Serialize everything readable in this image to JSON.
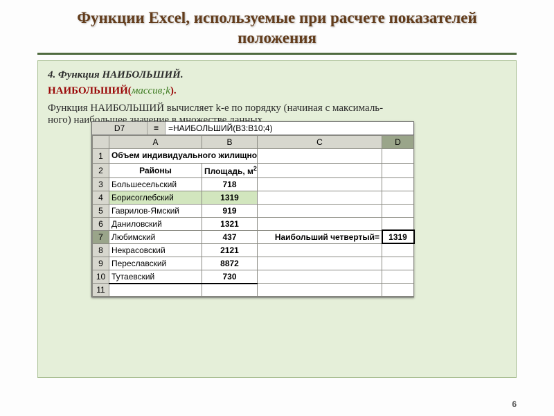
{
  "title": "Функции Excel, используемые при расчете показателей положения",
  "sec": "4. Функция НАИБОЛЬШИЙ.",
  "syntax": {
    "fn": "НАИБОЛЬШИЙ(",
    "arg": "массив;k",
    "close": ")."
  },
  "body_line": "Функция НАИБОЛЬШИЙ вычисляет k-е по порядку (начиная с максималь-\nного) наибольшее значение в множестве данных.",
  "excel": {
    "cellref": "D7",
    "eq": "=",
    "formula": "=НАИБОЛЬШИЙ(B3:B10;4)",
    "cols": [
      "A",
      "B",
      "C",
      "D"
    ],
    "header_text": "Объем индивидуального жилищного строительства по районам в Ярославской области",
    "h2": {
      "a": "Районы",
      "b_html": "Площадь, м<sup>2</sup>"
    },
    "rows": [
      {
        "n": "3",
        "a": "Большесельский",
        "b": "718"
      },
      {
        "n": "4",
        "a": "Борисоглебский",
        "b": "1319",
        "hl": true
      },
      {
        "n": "5",
        "a": "Гаврилов-Ямский",
        "b": "919"
      },
      {
        "n": "6",
        "a": "Даниловский",
        "b": "1321"
      },
      {
        "n": "7",
        "a": "Любимский",
        "b": "437",
        "sel": true,
        "c": "Наибольший четвертый=",
        "d": "1319"
      },
      {
        "n": "8",
        "a": "Некрасовский",
        "b": "2121"
      },
      {
        "n": "9",
        "a": "Переславский",
        "b": "8872"
      },
      {
        "n": "10",
        "a": "Тутаевский",
        "b": "730"
      }
    ],
    "tail_row": "11"
  },
  "pagenum": "6"
}
